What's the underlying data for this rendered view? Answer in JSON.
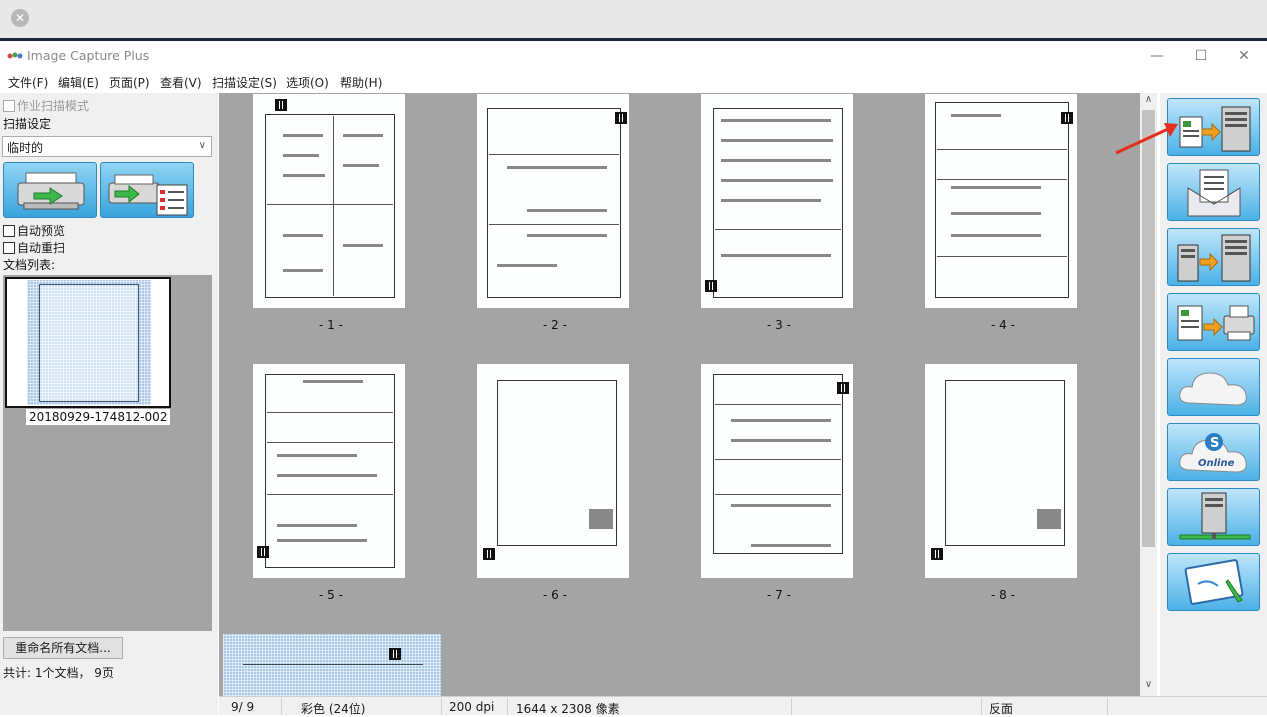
{
  "app": {
    "title": "Image Capture Plus",
    "window_controls": {
      "minimize": "—",
      "maximize": "☐",
      "close": "✕"
    }
  },
  "menu": [
    "文件(F)",
    "编辑(E)",
    "页面(P)",
    "查看(V)",
    "扫描设定(S)",
    "选项(O)",
    "帮助(H)"
  ],
  "left": {
    "job_scan_mode": "作业扫描模式",
    "scan_settings_label": "扫描设定",
    "profile_select": "临时的",
    "auto_preview": "自动预览",
    "auto_rescan": "自动重扫",
    "doc_list_label": "文档列表:",
    "doc_name": "20180929-174812-002",
    "rename_all": "重命名所有文档...",
    "total": "共计:   1个文档，    9页"
  },
  "pages": [
    {
      "label": "- 1 -"
    },
    {
      "label": "- 2 -"
    },
    {
      "label": "- 3 -"
    },
    {
      "label": "- 4 -"
    },
    {
      "label": "- 5 -"
    },
    {
      "label": "- 6 -"
    },
    {
      "label": "- 7 -"
    },
    {
      "label": "- 8 -"
    }
  ],
  "status": {
    "page_index": "9/   9",
    "color_mode": "彩色 (24位)",
    "dpi": "200 dpi",
    "size": "1644 x  2308 像素",
    "side": "反面"
  },
  "right_toolbar": [
    {
      "icon": "scan-to-server-icon"
    },
    {
      "icon": "scan-to-email-icon"
    },
    {
      "icon": "transfer-to-server-icon"
    },
    {
      "icon": "scan-to-printer-icon"
    },
    {
      "icon": "cloud-icon"
    },
    {
      "icon": "sharepoint-online-icon"
    },
    {
      "icon": "network-server-icon"
    },
    {
      "icon": "edit-document-icon"
    }
  ],
  "colors": {
    "accent": "#3aa3dc",
    "arrow": "#e53020"
  }
}
